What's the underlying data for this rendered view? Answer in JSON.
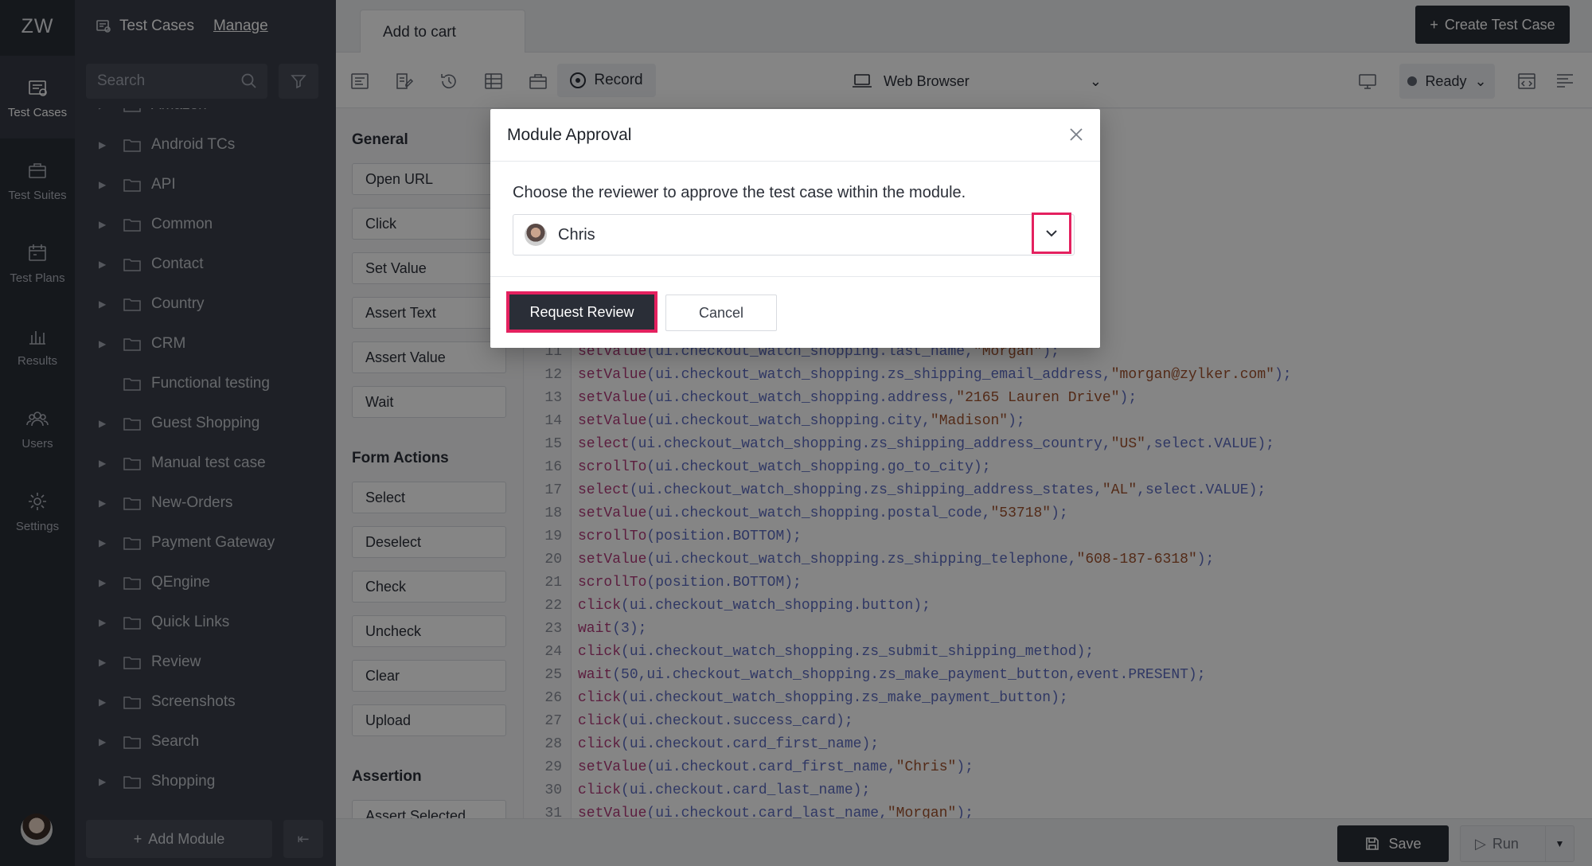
{
  "app": {
    "logo": "ZW"
  },
  "nav": {
    "items": [
      {
        "label": "Test Cases",
        "icon": "test-cases-icon",
        "active": true
      },
      {
        "label": "Test Suites",
        "icon": "test-suites-icon",
        "active": false
      },
      {
        "label": "Test Plans",
        "icon": "test-plans-icon",
        "active": false
      },
      {
        "label": "Results",
        "icon": "results-icon",
        "active": false
      },
      {
        "label": "Users",
        "icon": "users-icon",
        "active": false
      },
      {
        "label": "Settings",
        "icon": "settings-icon",
        "active": false
      }
    ]
  },
  "modules": {
    "title": "Test Cases",
    "manage": "Manage",
    "search_placeholder": "Search",
    "tree": [
      {
        "label": "Amazon",
        "expandable": true
      },
      {
        "label": "Android TCs",
        "expandable": true
      },
      {
        "label": "API",
        "expandable": true
      },
      {
        "label": "Common",
        "expandable": true
      },
      {
        "label": "Contact",
        "expandable": true
      },
      {
        "label": "Country",
        "expandable": true
      },
      {
        "label": "CRM",
        "expandable": true
      },
      {
        "label": "Functional testing",
        "expandable": false
      },
      {
        "label": "Guest Shopping",
        "expandable": true
      },
      {
        "label": "Manual test case",
        "expandable": true
      },
      {
        "label": "New-Orders",
        "expandable": true
      },
      {
        "label": "Payment Gateway",
        "expandable": true
      },
      {
        "label": "QEngine",
        "expandable": true
      },
      {
        "label": "Quick Links",
        "expandable": true
      },
      {
        "label": "Review",
        "expandable": true
      },
      {
        "label": "Screenshots",
        "expandable": true
      },
      {
        "label": "Search",
        "expandable": true
      },
      {
        "label": "Shopping",
        "expandable": true
      }
    ],
    "add_module": "Add Module"
  },
  "header": {
    "tab": "Add to cart",
    "create_button": "Create Test Case"
  },
  "toolbar": {
    "record": "Record",
    "browser": "Web Browser",
    "status": "Ready"
  },
  "actions": {
    "general_title": "General",
    "general": [
      "Open URL",
      "Click",
      "Set Value",
      "Assert Text",
      "Assert Value",
      "Wait"
    ],
    "form_title": "Form Actions",
    "form": [
      "Select",
      "Deselect",
      "Check",
      "Uncheck",
      "Clear",
      "Upload"
    ],
    "assertion_title": "Assertion",
    "assertion": [
      "Assert Selected"
    ]
  },
  "code": [
    {
      "n": "11",
      "segs": [
        [
          "fn",
          "setValue"
        ],
        [
          "",
          "(ui.checkout_watch_shopping.last_name,"
        ],
        [
          "str",
          "\"Morgan\""
        ],
        [
          "",
          ");"
        ]
      ]
    },
    {
      "n": "12",
      "segs": [
        [
          "fn",
          "setValue"
        ],
        [
          "",
          "(ui.checkout_watch_shopping.zs_shipping_email_address,"
        ],
        [
          "str",
          "\"morgan@zylker.com\""
        ],
        [
          "",
          ");"
        ]
      ]
    },
    {
      "n": "13",
      "segs": [
        [
          "fn",
          "setValue"
        ],
        [
          "",
          "(ui.checkout_watch_shopping.address,"
        ],
        [
          "str",
          "\"2165 Lauren Drive\""
        ],
        [
          "",
          ");"
        ]
      ]
    },
    {
      "n": "14",
      "segs": [
        [
          "fn",
          "setValue"
        ],
        [
          "",
          "(ui.checkout_watch_shopping.city,"
        ],
        [
          "str",
          "\"Madison\""
        ],
        [
          "",
          ");"
        ]
      ]
    },
    {
      "n": "15",
      "segs": [
        [
          "fn",
          "select"
        ],
        [
          "",
          "(ui.checkout_watch_shopping.zs_shipping_address_country,"
        ],
        [
          "str",
          "\"US\""
        ],
        [
          "",
          ",select.VALUE);"
        ]
      ]
    },
    {
      "n": "16",
      "segs": [
        [
          "fn",
          "scrollTo"
        ],
        [
          "",
          "(ui.checkout_watch_shopping.go_to_city);"
        ]
      ]
    },
    {
      "n": "17",
      "segs": [
        [
          "fn",
          "select"
        ],
        [
          "",
          "(ui.checkout_watch_shopping.zs_shipping_address_states,"
        ],
        [
          "str",
          "\"AL\""
        ],
        [
          "",
          ",select.VALUE);"
        ]
      ]
    },
    {
      "n": "18",
      "segs": [
        [
          "fn",
          "setValue"
        ],
        [
          "",
          "(ui.checkout_watch_shopping.postal_code,"
        ],
        [
          "str",
          "\"53718\""
        ],
        [
          "",
          ");"
        ]
      ]
    },
    {
      "n": "19",
      "segs": [
        [
          "fn",
          "scrollTo"
        ],
        [
          "",
          "(position.BOTTOM);"
        ]
      ]
    },
    {
      "n": "20",
      "segs": [
        [
          "fn",
          "setValue"
        ],
        [
          "",
          "(ui.checkout_watch_shopping.zs_shipping_telephone,"
        ],
        [
          "str",
          "\"608-187-6318\""
        ],
        [
          "",
          ");"
        ]
      ]
    },
    {
      "n": "21",
      "segs": [
        [
          "fn",
          "scrollTo"
        ],
        [
          "",
          "(position.BOTTOM);"
        ]
      ]
    },
    {
      "n": "22",
      "segs": [
        [
          "fn",
          "click"
        ],
        [
          "",
          "(ui.checkout_watch_shopping.button);"
        ]
      ]
    },
    {
      "n": "23",
      "segs": [
        [
          "fn",
          "wait"
        ],
        [
          "",
          "(3);"
        ]
      ]
    },
    {
      "n": "24",
      "segs": [
        [
          "fn",
          "click"
        ],
        [
          "",
          "(ui.checkout_watch_shopping.zs_submit_shipping_method);"
        ]
      ]
    },
    {
      "n": "25",
      "segs": [
        [
          "fn",
          "wait"
        ],
        [
          "",
          "(50,ui.checkout_watch_shopping.zs_make_payment_button,event.PRESENT);"
        ]
      ]
    },
    {
      "n": "26",
      "segs": [
        [
          "fn",
          "click"
        ],
        [
          "",
          "(ui.checkout_watch_shopping.zs_make_payment_button);"
        ]
      ]
    },
    {
      "n": "27",
      "segs": [
        [
          "fn",
          "click"
        ],
        [
          "",
          "(ui.checkout.success_card);"
        ]
      ]
    },
    {
      "n": "28",
      "segs": [
        [
          "fn",
          "click"
        ],
        [
          "",
          "(ui.checkout.card_first_name);"
        ]
      ]
    },
    {
      "n": "29",
      "segs": [
        [
          "fn",
          "setValue"
        ],
        [
          "",
          "(ui.checkout.card_first_name,"
        ],
        [
          "str",
          "\"Chris\""
        ],
        [
          "",
          ");"
        ]
      ]
    },
    {
      "n": "30",
      "segs": [
        [
          "fn",
          "click"
        ],
        [
          "",
          "(ui.checkout.card_last_name);"
        ]
      ]
    },
    {
      "n": "31",
      "segs": [
        [
          "fn",
          "setValue"
        ],
        [
          "",
          "(ui.checkout.card_last_name,"
        ],
        [
          "str",
          "\"Morgan\""
        ],
        [
          "",
          ");"
        ]
      ]
    }
  ],
  "footer": {
    "save": "Save",
    "run": "Run"
  },
  "modal": {
    "title": "Module Approval",
    "message": "Choose the reviewer to approve the test case within the module.",
    "reviewer": "Chris",
    "primary": "Request Review",
    "secondary": "Cancel"
  },
  "colors": {
    "highlight": "#e4215f",
    "dark": "#2a2e37"
  }
}
